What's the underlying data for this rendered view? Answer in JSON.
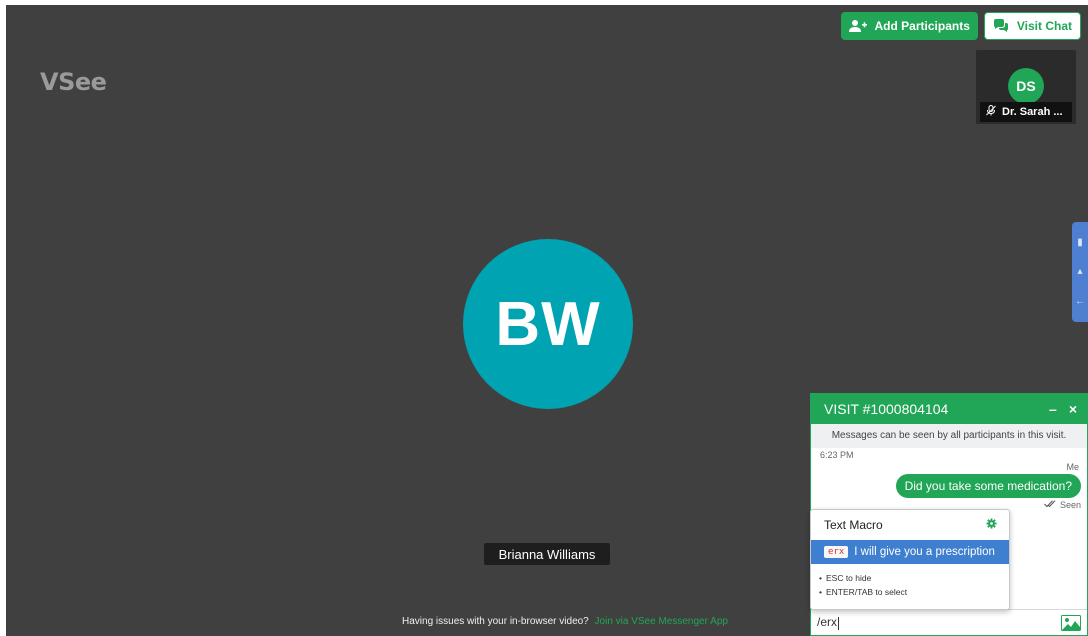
{
  "app": {
    "logo": "VSee"
  },
  "header": {
    "add_participants_label": "Add Participants",
    "visit_chat_label": "Visit Chat"
  },
  "self_view": {
    "initials": "DS",
    "name": "Dr. Sarah ..."
  },
  "main_participant": {
    "initials": "BW",
    "name": "Brianna Williams"
  },
  "footer": {
    "issue_text": "Having issues with your in-browser video?",
    "link_text": "Join via VSee Messenger App"
  },
  "chat": {
    "title": "VISIT #1000804104",
    "minimize_label": "–",
    "close_label": "×",
    "notice": "Messages can be seen by all participants in this visit.",
    "time": "6:23 PM",
    "sender": "Me",
    "message": "Did you take some medication?",
    "status": "Seen",
    "input_value": "/erx"
  },
  "macro": {
    "title": "Text Macro",
    "item_code": "erx",
    "item_text": "I will give you a prescription",
    "hints": [
      "ESC to hide",
      "ENTER/TAB to select"
    ]
  },
  "colors": {
    "stage_bg": "#404040",
    "brand_green": "#21a556",
    "avatar_teal": "#00a3b2",
    "macro_highlight": "#3f7fcf",
    "side_tools": "#4f7fd1"
  },
  "icons": {
    "add_participants": "add-user-icon",
    "visit_chat": "chat-bubbles-icon",
    "mic_muted": "mic-muted-icon",
    "settings": "gear-icon",
    "image_upload": "image-icon",
    "read_receipt": "double-check-icon"
  }
}
